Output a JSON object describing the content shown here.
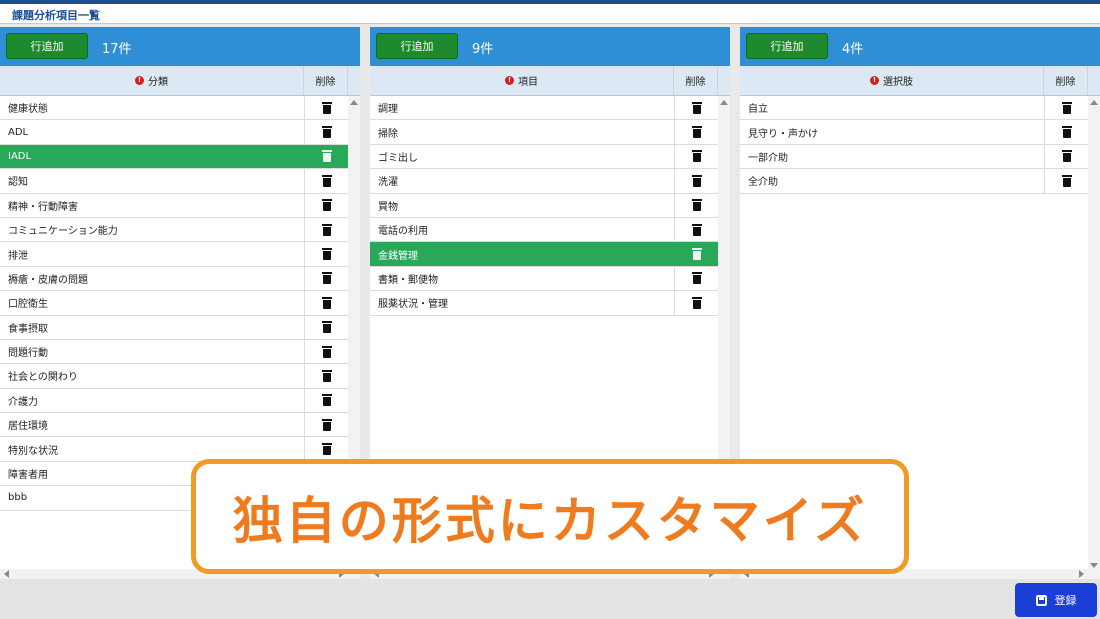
{
  "window": {
    "title": "課題分析項目一覧"
  },
  "panels": [
    {
      "add_label": "行追加",
      "count": "17件",
      "column_label": "分類",
      "delete_label": "削除",
      "rows": [
        {
          "text": "健康状態",
          "selected": false
        },
        {
          "text": "ADL",
          "selected": false
        },
        {
          "text": "IADL",
          "selected": true
        },
        {
          "text": "認知",
          "selected": false
        },
        {
          "text": "精神・行動障害",
          "selected": false
        },
        {
          "text": "コミュニケーション能力",
          "selected": false
        },
        {
          "text": "排泄",
          "selected": false
        },
        {
          "text": "褥瘡・皮膚の問題",
          "selected": false
        },
        {
          "text": "口腔衛生",
          "selected": false
        },
        {
          "text": "食事摂取",
          "selected": false
        },
        {
          "text": "問題行動",
          "selected": false
        },
        {
          "text": "社会との関わり",
          "selected": false
        },
        {
          "text": "介護力",
          "selected": false
        },
        {
          "text": "居住環境",
          "selected": false
        },
        {
          "text": "特別な状況",
          "selected": false
        },
        {
          "text": "障害者用",
          "selected": false
        },
        {
          "text": "bbb",
          "selected": false
        }
      ]
    },
    {
      "add_label": "行追加",
      "count": "9件",
      "column_label": "項目",
      "delete_label": "削除",
      "rows": [
        {
          "text": "調理",
          "selected": false
        },
        {
          "text": "掃除",
          "selected": false
        },
        {
          "text": "ゴミ出し",
          "selected": false
        },
        {
          "text": "洗濯",
          "selected": false
        },
        {
          "text": "買物",
          "selected": false
        },
        {
          "text": "電話の利用",
          "selected": false
        },
        {
          "text": "金銭管理",
          "selected": true
        },
        {
          "text": "書類・郵便物",
          "selected": false
        },
        {
          "text": "服薬状況・管理",
          "selected": false
        }
      ]
    },
    {
      "add_label": "行追加",
      "count": "4件",
      "column_label": "選択肢",
      "delete_label": "削除",
      "rows": [
        {
          "text": "自立",
          "selected": false
        },
        {
          "text": "見守り・声かけ",
          "selected": false
        },
        {
          "text": "一部介助",
          "selected": false
        },
        {
          "text": "全介助",
          "selected": false
        }
      ]
    }
  ],
  "footer": {
    "register_label": "登録"
  },
  "callout": {
    "text": "独自の形式にカスタマイズ"
  },
  "colors": {
    "header_blue": "#2e8fd6",
    "add_green": "#1d8a2e",
    "selected_green": "#2aa85a",
    "register_blue": "#1a3fd6",
    "callout_orange": "#f09a27"
  },
  "icons": {
    "delete": "trash-icon",
    "register": "save-disk-icon",
    "required": "required-dot-icon"
  }
}
